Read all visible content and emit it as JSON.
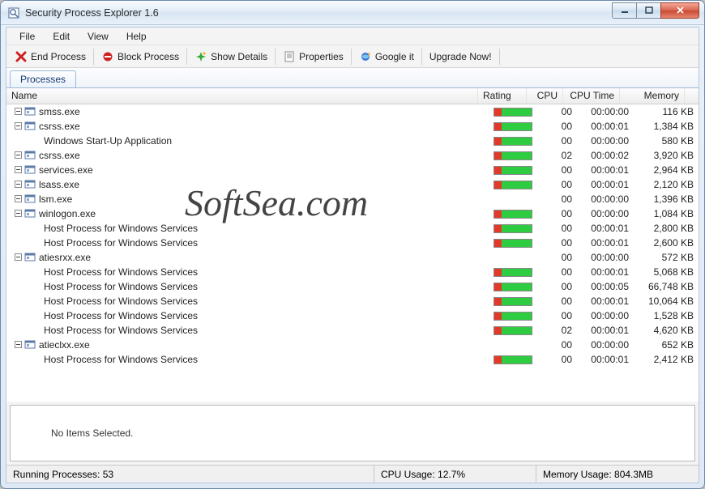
{
  "window": {
    "title": "Security Process Explorer 1.6"
  },
  "menubar": [
    "File",
    "Edit",
    "View",
    "Help"
  ],
  "toolbar": {
    "end_process": "End Process",
    "block_process": "Block Process",
    "show_details": "Show Details",
    "properties": "Properties",
    "google_it": "Google it",
    "upgrade": "Upgrade Now!"
  },
  "tab_label": "Processes",
  "columns": {
    "name": "Name",
    "rating": "Rating",
    "cpu": "CPU",
    "cpu_time": "CPU Time",
    "memory": "Memory"
  },
  "processes": [
    {
      "indent": 0,
      "icon": true,
      "name": "smss.exe",
      "rating": true,
      "cpu": "00",
      "cpu_time": "00:00:00",
      "memory": "116 KB"
    },
    {
      "indent": 0,
      "icon": true,
      "name": "csrss.exe",
      "rating": true,
      "cpu": "00",
      "cpu_time": "00:00:01",
      "memory": "1,384 KB"
    },
    {
      "indent": 1,
      "icon": false,
      "name": "Windows Start-Up Application",
      "rating": true,
      "cpu": "00",
      "cpu_time": "00:00:00",
      "memory": "580 KB"
    },
    {
      "indent": 0,
      "icon": true,
      "name": "csrss.exe",
      "rating": true,
      "cpu": "02",
      "cpu_time": "00:00:02",
      "memory": "3,920 KB"
    },
    {
      "indent": 0,
      "icon": true,
      "name": "services.exe",
      "rating": true,
      "cpu": "00",
      "cpu_time": "00:00:01",
      "memory": "2,964 KB"
    },
    {
      "indent": 0,
      "icon": true,
      "name": "lsass.exe",
      "rating": true,
      "cpu": "00",
      "cpu_time": "00:00:01",
      "memory": "2,120 KB"
    },
    {
      "indent": 0,
      "icon": true,
      "name": "lsm.exe",
      "rating": false,
      "cpu": "00",
      "cpu_time": "00:00:00",
      "memory": "1,396 KB"
    },
    {
      "indent": 0,
      "icon": true,
      "name": "winlogon.exe",
      "rating": true,
      "cpu": "00",
      "cpu_time": "00:00:00",
      "memory": "1,084 KB"
    },
    {
      "indent": 1,
      "icon": false,
      "name": "Host Process for Windows Services",
      "rating": true,
      "cpu": "00",
      "cpu_time": "00:00:01",
      "memory": "2,800 KB"
    },
    {
      "indent": 1,
      "icon": false,
      "name": "Host Process for Windows Services",
      "rating": true,
      "cpu": "00",
      "cpu_time": "00:00:01",
      "memory": "2,600 KB"
    },
    {
      "indent": 0,
      "icon": true,
      "name": "atiesrxx.exe",
      "rating": false,
      "cpu": "00",
      "cpu_time": "00:00:00",
      "memory": "572 KB"
    },
    {
      "indent": 1,
      "icon": false,
      "name": "Host Process for Windows Services",
      "rating": true,
      "cpu": "00",
      "cpu_time": "00:00:01",
      "memory": "5,068 KB"
    },
    {
      "indent": 1,
      "icon": false,
      "name": "Host Process for Windows Services",
      "rating": true,
      "cpu": "00",
      "cpu_time": "00:00:05",
      "memory": "66,748 KB"
    },
    {
      "indent": 1,
      "icon": false,
      "name": "Host Process for Windows Services",
      "rating": true,
      "cpu": "00",
      "cpu_time": "00:00:01",
      "memory": "10,064 KB"
    },
    {
      "indent": 1,
      "icon": false,
      "name": "Host Process for Windows Services",
      "rating": true,
      "cpu": "00",
      "cpu_time": "00:00:00",
      "memory": "1,528 KB"
    },
    {
      "indent": 1,
      "icon": false,
      "name": "Host Process for Windows Services",
      "rating": true,
      "cpu": "02",
      "cpu_time": "00:00:01",
      "memory": "4,620 KB"
    },
    {
      "indent": 0,
      "icon": true,
      "name": "atieclxx.exe",
      "rating": false,
      "cpu": "00",
      "cpu_time": "00:00:00",
      "memory": "652 KB"
    },
    {
      "indent": 1,
      "icon": false,
      "name": "Host Process for Windows Services",
      "rating": true,
      "cpu": "00",
      "cpu_time": "00:00:01",
      "memory": "2,412 KB"
    }
  ],
  "detail_pane": "No Items Selected.",
  "status": {
    "running": "Running Processes: 53",
    "cpu": "CPU Usage: 12.7%",
    "memory": "Memory Usage: 804.3MB"
  },
  "watermark": "SoftSea.com"
}
